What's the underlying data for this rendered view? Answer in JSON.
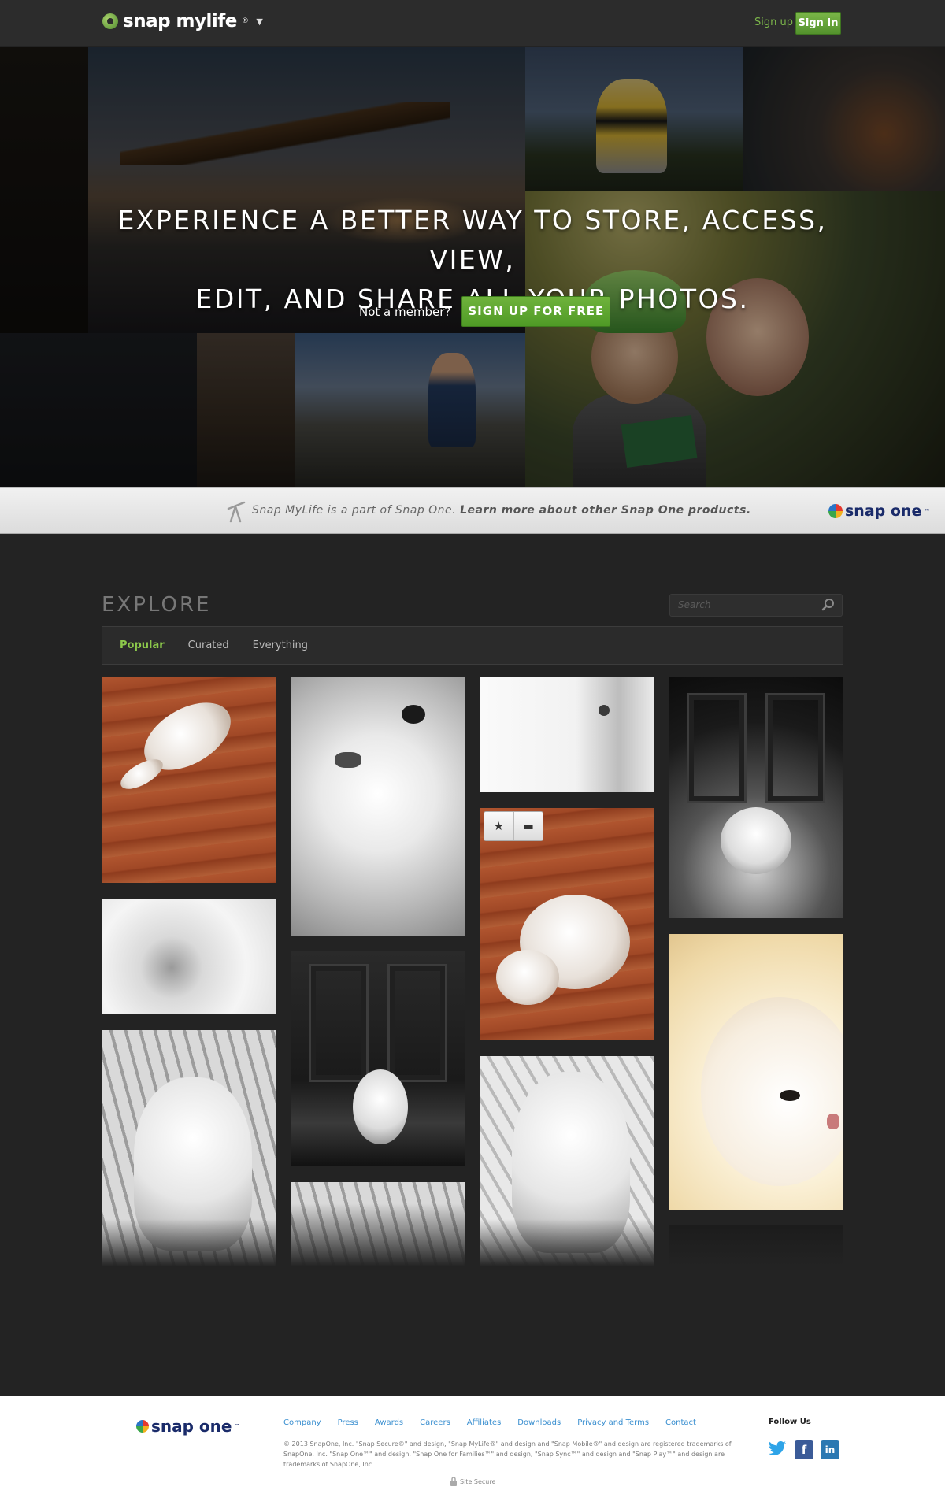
{
  "header": {
    "logo_text": "snap mylife",
    "logo_reg": "®",
    "signup_label": "Sign up",
    "signin_label": "Sign In"
  },
  "hero": {
    "title_line1": "EXPERIENCE A BETTER WAY TO STORE, ACCESS, VIEW,",
    "title_line2": "EDIT, AND SHARE ALL YOUR PHOTOS.",
    "not_member": "Not a member?",
    "cta_label": "SIGN UP FOR FREE"
  },
  "promo": {
    "text_italic": "Snap MyLife is a part of Snap One.",
    "text_bold": "Learn more about other Snap One products.",
    "logo_text": "snap one",
    "logo_tm": "™"
  },
  "explore": {
    "title": "EXPLORE",
    "search_placeholder": "Search",
    "tabs": [
      "Popular",
      "Curated",
      "Everything"
    ],
    "active_tab": "Popular"
  },
  "footer": {
    "logo_text": "snap one",
    "logo_tm": "™",
    "links": [
      "Company",
      "Press",
      "Awards",
      "Careers",
      "Affiliates",
      "Downloads",
      "Privacy and Terms",
      "Contact"
    ],
    "copyright": "© 2013 SnapOne, Inc. \"Snap Secure®\" and design, \"Snap MyLife®\" and design and \"Snap Mobile®\" and design are registered trademarks of SnapOne, Inc. \"Snap One™\" and design, \"Snap One for Families™\" and design, \"Snap Sync™\" and design and \"Snap Play™\" and design are trademarks of SnapOne, Inc.",
    "site_secure": "Site Secure",
    "follow_us": "Follow Us"
  },
  "icons": {
    "logo": "snap-mylife-logo-icon",
    "dropdown": "chevron-down-icon",
    "promo": "telescope-icon",
    "search": "search-icon",
    "star": "star-icon",
    "comment": "comment-icon",
    "lock": "lock-icon",
    "twitter": "twitter-icon",
    "facebook": "facebook-icon",
    "linkedin": "linkedin-icon"
  },
  "colors": {
    "accent_green": "#6fb33c",
    "link_blue": "#3a8fd0",
    "background": "#232323"
  }
}
